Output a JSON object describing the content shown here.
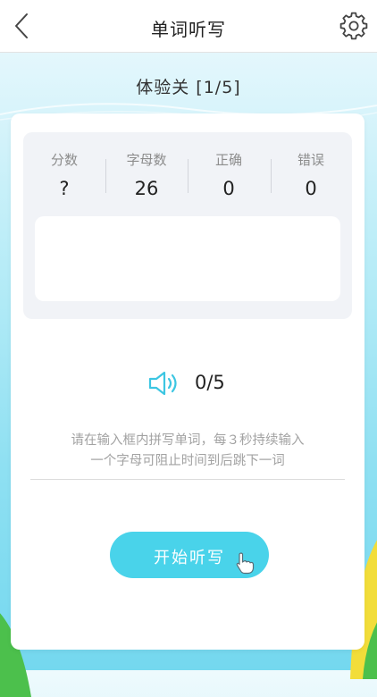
{
  "navbar": {
    "title": "单词听写",
    "back_icon": "chevron-left-icon",
    "settings_icon": "gear-icon"
  },
  "level": {
    "title": "体验关 [1/5]"
  },
  "stats": {
    "score_label": "分数",
    "score_value": "?",
    "letters_label": "字母数",
    "letters_value": "26",
    "correct_label": "正确",
    "correct_value": "0",
    "wrong_label": "错误",
    "wrong_value": "0"
  },
  "audio": {
    "icon": "speaker-icon",
    "progress": "0/5"
  },
  "hint": {
    "line1": "请在输入框内拼写单词，每３秒持续输入",
    "line2": "一个字母可阻止时间到后跳下一词"
  },
  "start_button": {
    "label": "开始听写",
    "icon": "hand-pointer-icon"
  },
  "colors": {
    "accent": "#49d3ea",
    "background_top": "#eefafd",
    "background_bottom": "#74d8ef",
    "hill_green": "#4cc04c",
    "hill_yellow": "#f2dd3a"
  }
}
